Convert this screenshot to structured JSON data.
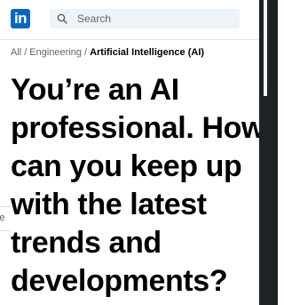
{
  "nav": {
    "logo_text": "in",
    "search": {
      "placeholder": "Search",
      "icon": "search-icon"
    }
  },
  "breadcrumb": {
    "items": [
      "All",
      "Engineering"
    ],
    "separator": "/",
    "current": "Artificial Intelligence (AI)"
  },
  "article": {
    "title": "You’re an AI professional. How can you keep up with the latest trends and developments?"
  },
  "background": {
    "partial_text": "le"
  },
  "colors": {
    "brand": "#0a66c2",
    "search_bg": "#eef3f8",
    "frame": "#1d2226"
  }
}
